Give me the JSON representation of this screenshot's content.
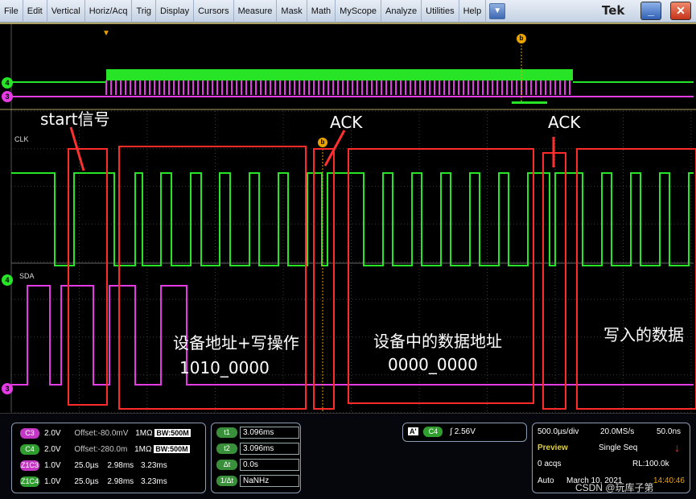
{
  "menu": {
    "items": [
      "File",
      "Edit",
      "Vertical",
      "Horiz/Acq",
      "Trig",
      "Display",
      "Cursors",
      "Measure",
      "Mask",
      "Math",
      "MyScope",
      "Analyze",
      "Utilities",
      "Help"
    ],
    "dropdown_glyph": "▼",
    "brand": "Tek",
    "minimize_glyph": "_",
    "close_glyph": "✕"
  },
  "scope": {
    "annotations": {
      "start": "start信号",
      "ack1": "ACK",
      "ack2": "ACK",
      "device_addr": "设备地址+写操作",
      "device_addr_bits": "1010_0000",
      "mem_addr": "设备中的数据地址",
      "mem_addr_bits": "0000_0000",
      "write_data": "写入的数据"
    },
    "labels": {
      "clk": "CLK",
      "sda": "SDA"
    },
    "channel_markers": {
      "ch4": "4",
      "ch3": "3"
    },
    "cursor_marker": "b",
    "trigger_marker": "▼",
    "colors": {
      "ch4": "#27e427",
      "ch3": "#e43be4",
      "annotation_box": "#ff2a2a",
      "grid": "#3a3a3a",
      "cursor": "#e9a400"
    }
  },
  "readouts": {
    "channels": [
      {
        "chip": "C3",
        "scale": "2.0V",
        "offset": "Offset:-80.0mV",
        "imp": "1MΩ",
        "bw": "BW:500M"
      },
      {
        "chip": "C4",
        "scale": "2.0V",
        "offset": "Offset:-280.0m",
        "imp": "1MΩ",
        "bw": "BW:500M"
      }
    ],
    "zooms": [
      {
        "chip": "Z1C3",
        "scale": "1.0V",
        "t1": "25.0µs",
        "t2": "2.98ms",
        "t3": "3.23ms"
      },
      {
        "chip": "Z1C4",
        "scale": "1.0V",
        "t1": "25.0µs",
        "t2": "2.98ms",
        "t3": "3.23ms"
      }
    ],
    "cursors": [
      {
        "label": "t1",
        "value": "3.096ms"
      },
      {
        "label": "t2",
        "value": "3.096ms"
      },
      {
        "label": "Δt",
        "value": "0.0s"
      },
      {
        "label": "1/Δt",
        "value": "NaNHz"
      }
    ],
    "trigger": {
      "mode_chip": "A'",
      "source": "C4",
      "edge": "∫",
      "level": "2.56V"
    },
    "acq": {
      "timebase": "500.0µs/div",
      "sample_rate": "20.0MS/s",
      "resolution": "50.0ns",
      "state": "Preview",
      "seq": "Single Seq",
      "acqs": "0 acqs",
      "record_length": "RL:100.0k",
      "trigger_mode": "Auto",
      "date": "March 10, 2021",
      "time": "14:40:46",
      "stop_glyph": "↓"
    },
    "watermark": "CSDN @玩库子第"
  }
}
